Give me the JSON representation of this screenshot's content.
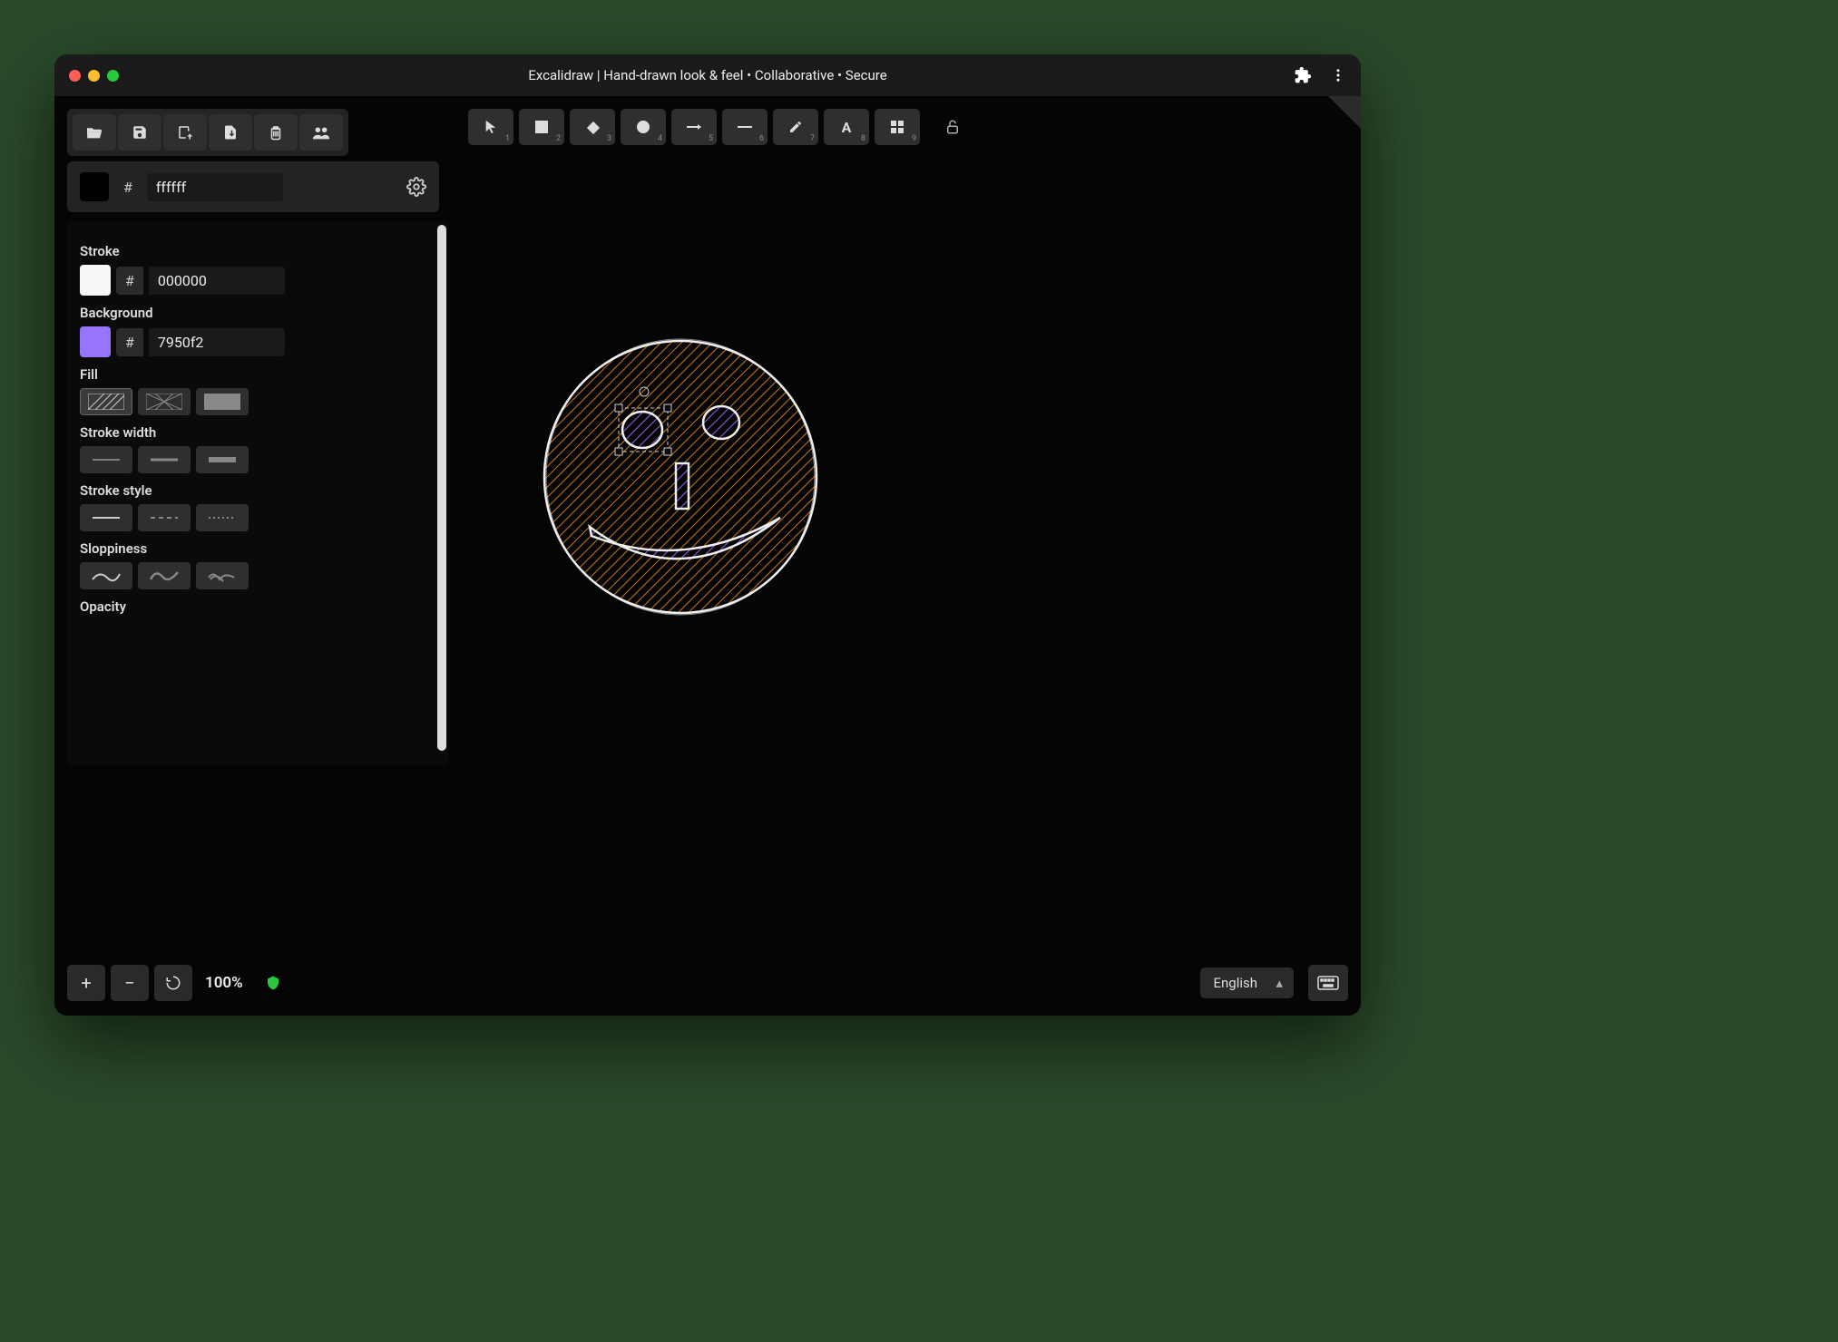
{
  "window": {
    "title": "Excalidraw | Hand-drawn look & feel • Collaborative • Secure"
  },
  "canvas_color": {
    "hash": "#",
    "value": "ffffff"
  },
  "tools": {
    "select": "1",
    "rectangle": "2",
    "diamond": "3",
    "ellipse": "4",
    "arrow": "5",
    "line": "6",
    "draw": "7",
    "text": "8",
    "image": "9"
  },
  "props": {
    "stroke": {
      "label": "Stroke",
      "hash": "#",
      "value": "000000"
    },
    "background": {
      "label": "Background",
      "hash": "#",
      "value": "7950f2"
    },
    "fill": {
      "label": "Fill"
    },
    "stroke_width": {
      "label": "Stroke width"
    },
    "stroke_style": {
      "label": "Stroke style"
    },
    "sloppiness": {
      "label": "Sloppiness"
    },
    "opacity": {
      "label": "Opacity"
    }
  },
  "footer": {
    "zoom": "100%",
    "language": "English"
  }
}
